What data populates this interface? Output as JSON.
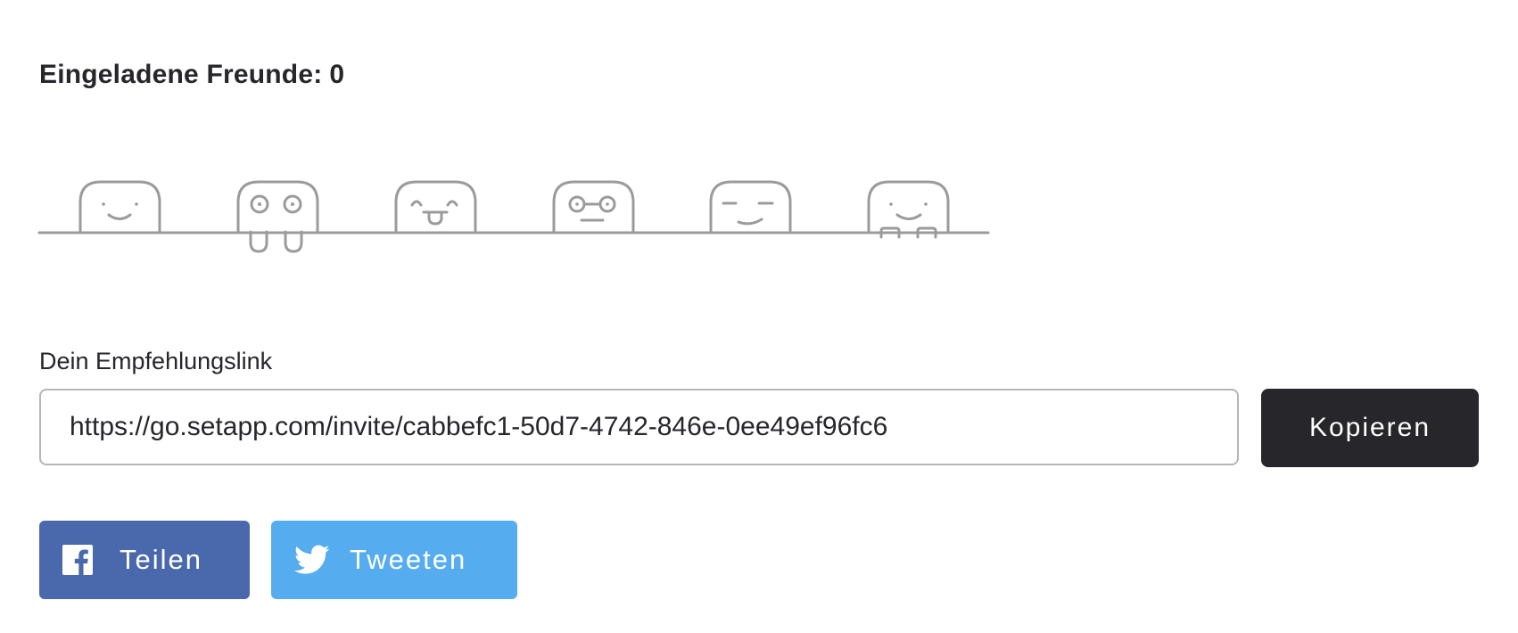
{
  "invited": {
    "label": "Eingeladene Freunde:",
    "count": "0"
  },
  "friends_illustration": {
    "faces": [
      "smile-face-icon",
      "drooling-face-icon",
      "tongue-face-icon",
      "glasses-face-icon",
      "squint-face-icon",
      "peeking-face-icon"
    ],
    "stroke_color": "#9b9b9e"
  },
  "referral": {
    "label": "Dein Empfehlungslink",
    "link": "https://go.setapp.com/invite/cabbefc1-50d7-4742-846e-0ee49ef96fc6",
    "copy_label": "Kopieren"
  },
  "share": {
    "facebook_label": "Teilen",
    "twitter_label": "Tweeten",
    "facebook_icon": "facebook-icon",
    "twitter_icon": "twitter-bird-icon"
  },
  "colors": {
    "text": "#26262b",
    "copy_button": "#26262b",
    "facebook": "#4a69ad",
    "twitter": "#55acee",
    "input_border": "#b6b6b9"
  }
}
